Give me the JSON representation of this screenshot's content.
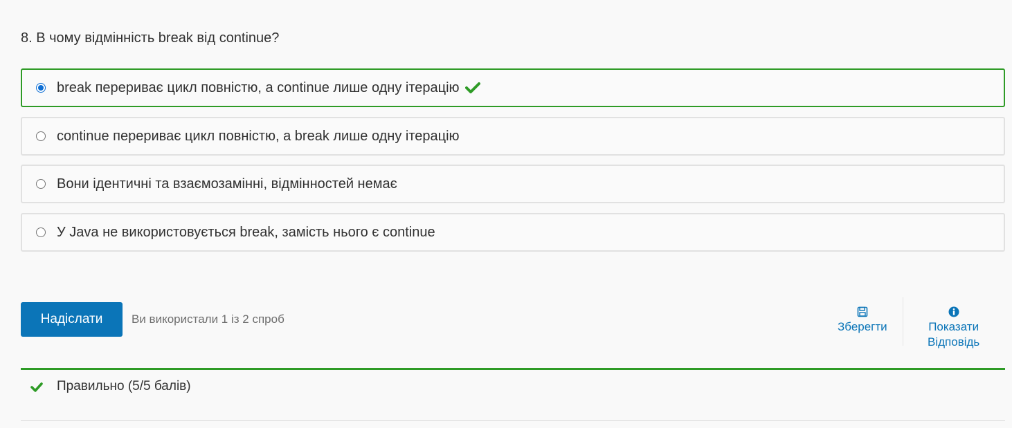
{
  "question": {
    "text": "8. В чому відмінність break від continue?"
  },
  "options": [
    {
      "label": "break перериває цикл повністю, а continue лише одну ітерацію",
      "selected": true,
      "correct": true
    },
    {
      "label": "continue перериває цикл повністю, a break лише одну ітерацію",
      "selected": false,
      "correct": false
    },
    {
      "label": "Вони ідентичні та взаємозамінні, відмінностей немає",
      "selected": false,
      "correct": false
    },
    {
      "label": "У Java не використовується break, замість нього є continue",
      "selected": false,
      "correct": false
    }
  ],
  "actions": {
    "submit_label": "Надіслати",
    "attempts_text": "Ви використали 1 із 2 спроб",
    "save_label": "Зберегти",
    "show_answer_line1": "Показати",
    "show_answer_line2": "Відповідь"
  },
  "result": {
    "text": "Правильно (5/5 балів)"
  },
  "colors": {
    "accent": "#0b75b8",
    "correct": "#2e9b26"
  },
  "icons": {
    "correct": "checkmark-icon",
    "save": "floppy-disk-icon",
    "info": "info-circle-icon"
  }
}
